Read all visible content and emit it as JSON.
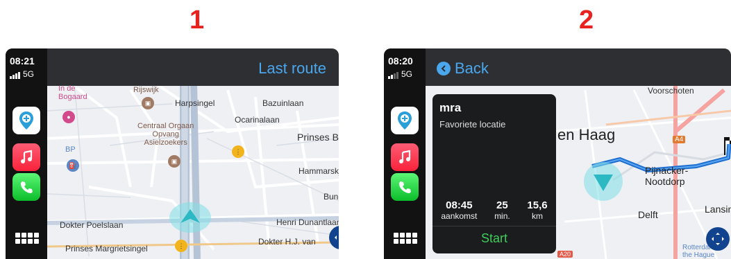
{
  "panels": [
    {
      "number": "1",
      "status": {
        "time": "08:21",
        "network": "5G"
      },
      "header": {
        "title": "Last route"
      },
      "map_labels": {
        "bogaard": "In de\nBogaard",
        "rijswijk": "Rijswijk",
        "harpsingel": "Harpsingel",
        "bazuinlaan": "Bazuinlaan",
        "ocarinalaan": "Ocarinalaan",
        "asiel": "Centraal Orgaan\nOpvang\nAsielzoekers",
        "prinses": "Prinses Be",
        "bp": "BP",
        "hammarskjold": "Hammarskjöld",
        "bunches": "Bunches",
        "poelslaan": "Dokter Poelslaan",
        "dunantlaan": "Henri Dunantlaan",
        "margrietsingel": "Prinses Margrietsingel",
        "hjvan": "Dokter H.J. van"
      }
    },
    {
      "number": "2",
      "status": {
        "time": "08:20",
        "network": "5G"
      },
      "header": {
        "back_label": "Back"
      },
      "card": {
        "destination": "mra",
        "subtitle": "Favoriete locatie",
        "stats": [
          {
            "value": "08:45",
            "unit": "aankomst"
          },
          {
            "value": "25",
            "unit": "min."
          },
          {
            "value": "15,6",
            "unit": "km"
          }
        ],
        "start_label": "Start"
      },
      "map_labels": {
        "voorschoten": "Voorschoten",
        "denhaag": "en Haag",
        "a4": "A4",
        "pijnacker": "Pijnacker-\nNootdorp",
        "delft": "Delft",
        "lansing": "Lansinge",
        "rotterdam": "Rotterdam\nthe Hague",
        "a20": "A20"
      }
    }
  ],
  "colors": {
    "accent": "#4aa7ee",
    "route": "#1f6fd1",
    "start": "#3fce5b",
    "label_red": "#e8231f"
  }
}
